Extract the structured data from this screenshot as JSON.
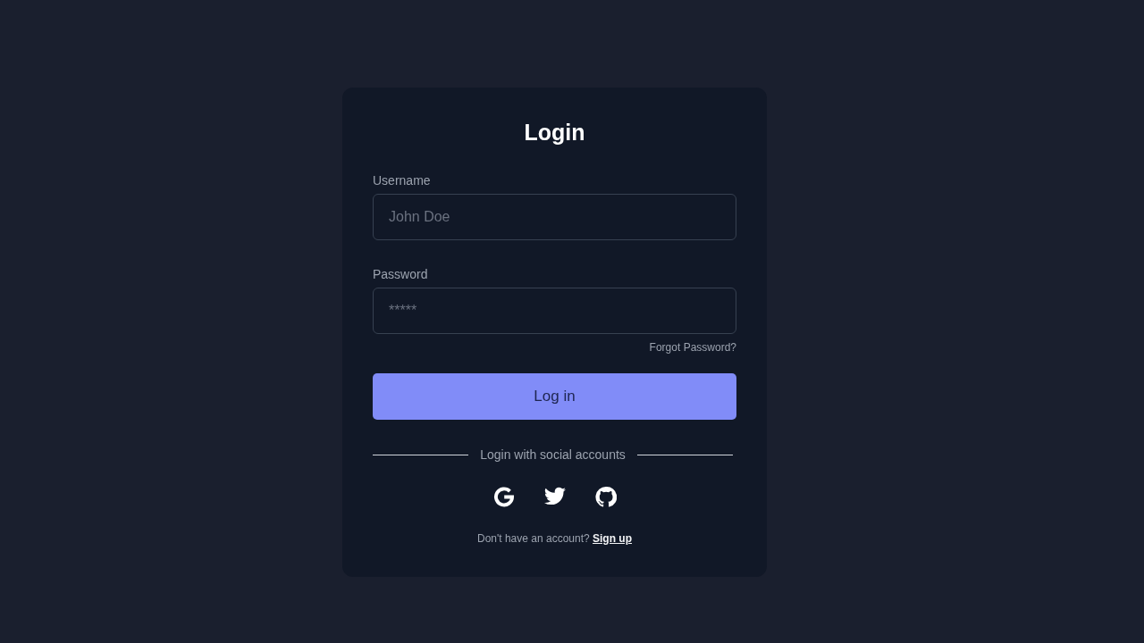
{
  "title": "Login",
  "fields": [
    {
      "label": "Username",
      "placeholder": "John Doe"
    },
    {
      "label": "Password",
      "placeholder": "*****"
    }
  ],
  "forgot_link": "Forgot Password?",
  "submit_button": "Log in",
  "social": {
    "divider": "Login with social accounts",
    "buttons": [
      {
        "kind": "google"
      },
      {
        "kind": "twitter"
      },
      {
        "kind": "github"
      }
    ]
  },
  "signup": {
    "prompt": "Don't have an account?",
    "link": "Sign up"
  }
}
